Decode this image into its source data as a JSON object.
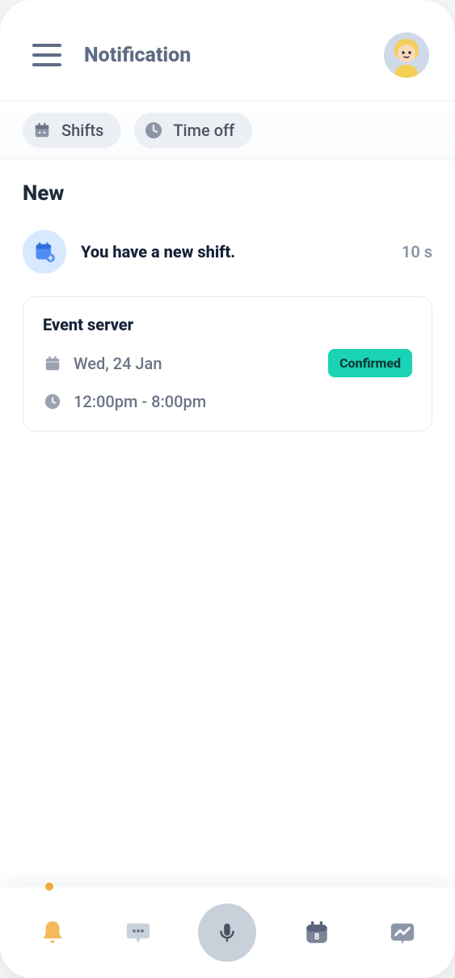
{
  "header": {
    "title": "Notification"
  },
  "filters": [
    {
      "label": "Shifts",
      "icon": "calendar"
    },
    {
      "label": "Time off",
      "icon": "clock"
    }
  ],
  "section_heading": "New",
  "notification": {
    "title": "You have a new shift.",
    "time": "10 s"
  },
  "shift_card": {
    "title": "Event server",
    "date": "Wed, 24 Jan",
    "time": "12:00pm - 8:00pm",
    "status": "Confirmed"
  },
  "bottom_nav": {
    "items": [
      {
        "name": "notifications",
        "icon": "bell",
        "active": true
      },
      {
        "name": "messages",
        "icon": "chat"
      },
      {
        "name": "voice",
        "icon": "mic",
        "center": true
      },
      {
        "name": "schedule",
        "icon": "calendar-date"
      },
      {
        "name": "insights",
        "icon": "trend"
      }
    ]
  }
}
